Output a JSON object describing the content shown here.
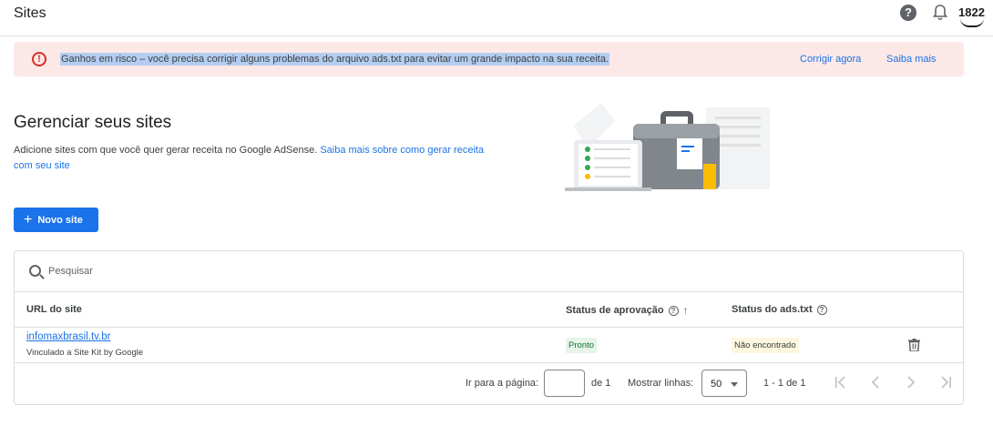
{
  "header": {
    "title": "Sites",
    "help_icon_glyph": "?",
    "account_label": "1822"
  },
  "alert": {
    "icon_glyph": "!",
    "message": "Ganhos em risco – você precisa corrigir alguns problemas do arquivo ads.txt para evitar um grande impacto na sua receita.",
    "fix_label": "Corrigir agora",
    "learn_label": "Saiba mais"
  },
  "page": {
    "title": "Gerenciar seus sites",
    "description": "Adicione sites com que você quer gerar receita no Google AdSense.",
    "description_link": "Saiba mais sobre como gerar receita com seu site",
    "new_site_icon": "+",
    "new_site_label": "Novo site"
  },
  "search": {
    "placeholder": "Pesquisar"
  },
  "table": {
    "columns": {
      "url": "URL do site",
      "approval": "Status de aprovação",
      "adstxt": "Status do ads.txt",
      "help_glyph": "?",
      "sort_glyph": "↑"
    },
    "rows": [
      {
        "url": "infomaxbrasil.tv.br",
        "subtitle": "Vinculado a Site Kit by Google",
        "approval_status": "Pronto",
        "adstxt_status": "Não encontrado"
      }
    ]
  },
  "pagination": {
    "goto_label": "Ir para a página:",
    "page_value": "",
    "of_label": "de 1",
    "rows_label": "Mostrar linhas:",
    "rows_value": "50",
    "range_label": "1 - 1 de 1"
  },
  "colors": {
    "accent": "#1a73e8",
    "alert_bg": "#fce8e6",
    "error": "#d93025",
    "ok_bg": "#e6f4ea",
    "warn_bg": "#fef7e0"
  }
}
